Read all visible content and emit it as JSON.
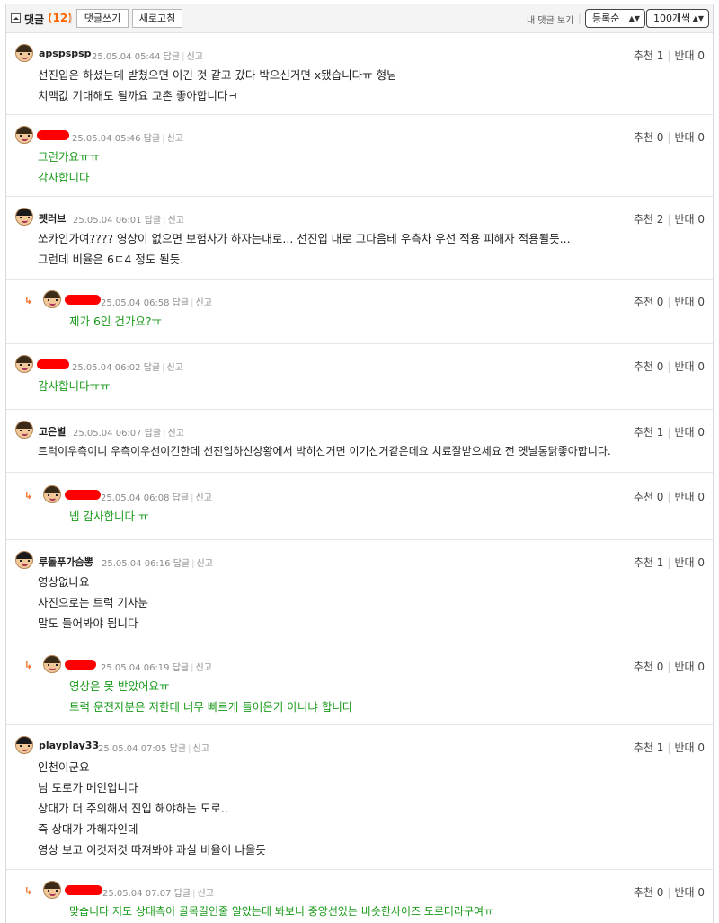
{
  "header": {
    "title": "댓글",
    "count": "(12)",
    "write_label": "댓글쓰기",
    "refresh_label": "새로고침",
    "my_comments_label": "내 댓글 보기",
    "sort_selected": "등록순",
    "per_page_selected": "100개씩"
  },
  "labels": {
    "reply": "답글",
    "report": "신고",
    "recommend": "추천",
    "oppose": "반대"
  },
  "comments": [
    {
      "nick": "apspspsp",
      "time": "25.05.04 05:44",
      "up": "1",
      "down": "0",
      "lines": [
        "선진입은 하셨는데 받쳤으면 이긴 것 같고 갔다 박으신거면 x됐습니다ㅠ 형님",
        "치맥값 기대해도 될까요 교촌 좋아합니다ㅋ"
      ]
    },
    {
      "nick": "",
      "time": "25.05.04 05:46",
      "up": "0",
      "down": "0",
      "lines": [
        "그런가요ㅠㅠ",
        "감사합니다"
      ]
    },
    {
      "nick": "펫러브",
      "time": "25.05.04 06:01",
      "up": "2",
      "down": "0",
      "lines": [
        "쏘카인가여???? 영상이 없으면 보험사가 하자는대로... 선진입 대로 그다음테 우측차 우선 적용 피해자 적용될듯...",
        "그런데 비율은 6ㄷ4 정도 될듯."
      ]
    },
    {
      "nick": "",
      "time": "25.05.04 06:58",
      "up": "0",
      "down": "0",
      "lines": [
        "제가 6인 건가요?ㅠ"
      ]
    },
    {
      "nick": "",
      "time": "25.05.04 06:02",
      "up": "0",
      "down": "0",
      "lines": [
        "감사합니다ㅠㅠ"
      ]
    },
    {
      "nick": "고은별",
      "time": "25.05.04 06:07",
      "up": "1",
      "down": "0",
      "lines": [
        "트럭이우측이니 우측이우선이긴한데 선진입하신상황에서 박히신거면 이기신거같은데요 치료잘받으세요 전 옛날통닭좋아합니다."
      ]
    },
    {
      "nick": "",
      "time": "25.05.04 06:08",
      "up": "0",
      "down": "0",
      "lines": [
        "넵 감사합니다 ㅠ"
      ]
    },
    {
      "nick": "루돌푸가슴뽕",
      "time": "25.05.04 06:16",
      "up": "1",
      "down": "0",
      "lines": [
        "영상없나요",
        "사진으로는 트럭 기사분",
        "말도 들어봐야 됩니다"
      ]
    },
    {
      "nick": "",
      "time": "25.05.04 06:19",
      "up": "0",
      "down": "0",
      "lines": [
        "영상은 못 받았어요ㅠ",
        "트럭 운전자분은 저한테 너무 빠르게 들어온거 아니냐 합니다"
      ]
    },
    {
      "nick": "playplay33",
      "time": "25.05.04 07:05",
      "up": "1",
      "down": "0",
      "lines": [
        "인천이군요",
        "님 도로가 메인입니다",
        "상대가 더 주의해서 진입 해야하는 도로..",
        "즉 상대가 가해자인데",
        "영상 보고 이것저것 따져봐야 과실 비율이 나올듯"
      ]
    },
    {
      "nick": "",
      "time": "25.05.04 07:07",
      "up": "0",
      "down": "0",
      "lines": [
        "맞습니다 저도 상대측이 골목길인줄 알았는데 봐보니 중앙선있는 비슷한사이즈 도로더라구여ㅠ"
      ]
    }
  ]
}
